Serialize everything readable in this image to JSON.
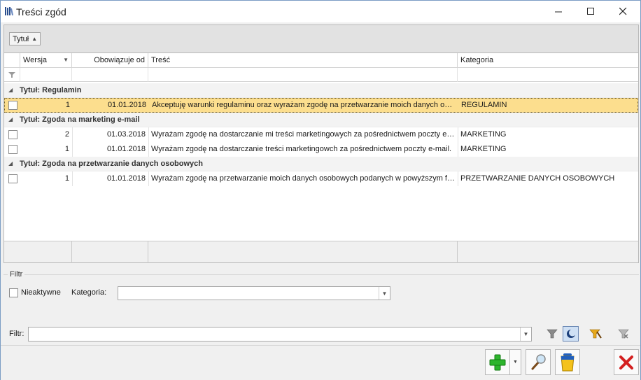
{
  "window": {
    "title": "Treści zgód"
  },
  "group_panel": {
    "chip_label": "Tytuł"
  },
  "columns": {
    "wersja": "Wersja",
    "obowiazuje_od": "Obowiązuje od",
    "tresc": "Treść",
    "kategoria": "Kategoria"
  },
  "groups": [
    {
      "label": "Tytuł: Regulamin",
      "rows": [
        {
          "wersja": "1",
          "date": "01.01.2018",
          "tresc": "Akceptuję warunki regulaminu oraz wyrażam zgodę na przetwarzanie moich danych oso...",
          "kategoria": "REGULAMIN",
          "selected": true
        }
      ]
    },
    {
      "label": "Tytuł: Zgoda na marketing e-mail",
      "rows": [
        {
          "wersja": "2",
          "date": "01.03.2018",
          "tresc": "Wyrażam zgodę na dostarczanie mi treści marketingowych za pośrednictwem poczty e-mail.",
          "kategoria": "MARKETING"
        },
        {
          "wersja": "1",
          "date": "01.01.2018",
          "tresc": "Wyrażam zgodę na dostarczanie treści marketingowch za pośrednictwem poczty e-mail.",
          "kategoria": "MARKETING"
        }
      ]
    },
    {
      "label": "Tytuł: Zgoda na przetwarzanie danych osobowych",
      "rows": [
        {
          "wersja": "1",
          "date": "01.01.2018",
          "tresc": "Wyrażam zgodę na przetwarzanie moich danych osobowych podanych w powyższym fo...",
          "kategoria": "PRZETWARZANIE DANYCH OSOBOWYCH"
        }
      ]
    }
  ],
  "filter_section": {
    "legend": "Filtr",
    "nieaktywne_label": "Nieaktywne",
    "kategoria_label": "Kategoria:",
    "kategoria_value": "",
    "filtr_label": "Filtr:",
    "filtr_value": ""
  },
  "colors": {
    "selected_row": "#fcde8e",
    "add_green": "#2db52d",
    "close_red": "#d42020",
    "bin_blue": "#1f5fbf",
    "bin_yellow": "#f4c21c"
  },
  "icons": {
    "app": "books-icon",
    "filter": "funnel-icon",
    "add": "plus-icon",
    "edit": "magnifier-icon",
    "delete": "trash-bin-icon",
    "close": "red-x-icon"
  }
}
